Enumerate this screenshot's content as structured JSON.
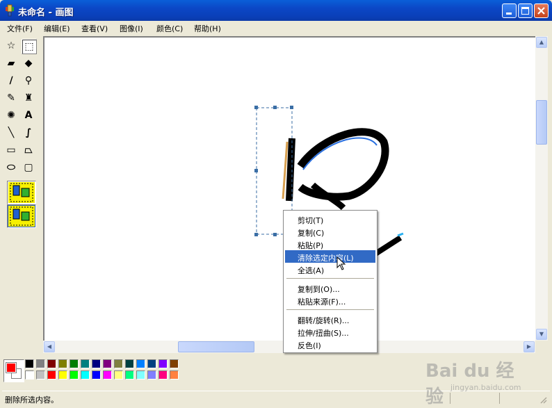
{
  "window": {
    "title": "未命名 - 画图",
    "controls": [
      "minimize",
      "maximize",
      "close"
    ]
  },
  "menubar": {
    "items": [
      "文件(F)",
      "编辑(E)",
      "查看(V)",
      "图像(I)",
      "颜色(C)",
      "帮助(H)"
    ]
  },
  "toolbox": {
    "tools": [
      {
        "name": "free-form-select-icon",
        "glyph": "☆"
      },
      {
        "name": "select-icon",
        "glyph": "⬚",
        "active": true
      },
      {
        "name": "eraser-icon",
        "glyph": "▰"
      },
      {
        "name": "fill-bucket-icon",
        "glyph": "◆"
      },
      {
        "name": "pick-color-icon",
        "glyph": "∕"
      },
      {
        "name": "magnifier-icon",
        "glyph": "⚲"
      },
      {
        "name": "pencil-icon",
        "glyph": "✎"
      },
      {
        "name": "brush-icon",
        "glyph": "♜"
      },
      {
        "name": "airbrush-icon",
        "glyph": "✺"
      },
      {
        "name": "text-icon",
        "glyph": "A"
      },
      {
        "name": "line-icon",
        "glyph": "╲"
      },
      {
        "name": "curve-icon",
        "glyph": "∫"
      },
      {
        "name": "rectangle-icon",
        "glyph": "▭"
      },
      {
        "name": "polygon-icon",
        "glyph": "⏢"
      },
      {
        "name": "ellipse-icon",
        "glyph": "⬭"
      },
      {
        "name": "rounded-rectangle-icon",
        "glyph": "▢"
      }
    ]
  },
  "context_menu": {
    "items": [
      {
        "label": "剪切(T)",
        "highlighted": false
      },
      {
        "label": "复制(C)",
        "highlighted": false
      },
      {
        "label": "粘贴(P)",
        "highlighted": false
      },
      {
        "label": "清除选定内容(L)",
        "highlighted": true
      },
      {
        "label": "全选(A)",
        "highlighted": false
      },
      {
        "label": "复制到(O)...",
        "highlighted": false
      },
      {
        "label": "粘贴来源(F)...",
        "highlighted": false
      },
      {
        "label": "翻转/旋转(R)...",
        "highlighted": false
      },
      {
        "label": "拉伸/扭曲(S)...",
        "highlighted": false
      },
      {
        "label": "反色(I)",
        "highlighted": false
      }
    ]
  },
  "palette": {
    "foreground": "#ff0000",
    "background": "#ffffff",
    "row1": [
      "#000000",
      "#808080",
      "#800000",
      "#808000",
      "#008000",
      "#008080",
      "#000080",
      "#800080",
      "#808040",
      "#004040",
      "#0080ff",
      "#004080",
      "#8000ff",
      "#804000"
    ],
    "row2": [
      "#ffffff",
      "#c0c0c0",
      "#ff0000",
      "#ffff00",
      "#00ff00",
      "#00ffff",
      "#0000ff",
      "#ff00ff",
      "#ffff80",
      "#00ff80",
      "#80ffff",
      "#8080ff",
      "#ff0080",
      "#ff8040"
    ]
  },
  "status": {
    "text": "删除所选内容。"
  },
  "watermark": {
    "brand": "Bai du 经验",
    "url": "jingyan.baidu.com"
  },
  "colors": {
    "title_bar": "#0b47c6",
    "menu_highlight": "#316ac5",
    "selection_border": "#3a6ea5"
  }
}
